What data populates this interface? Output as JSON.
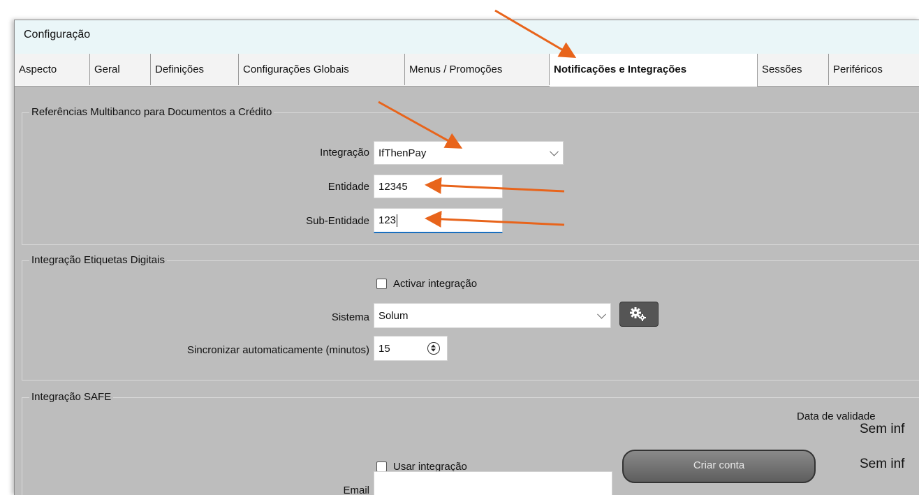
{
  "window": {
    "title": "Configuração"
  },
  "tabs": [
    {
      "label": "Aspecto"
    },
    {
      "label": "Geral"
    },
    {
      "label": "Definições"
    },
    {
      "label": "Configurações Globais"
    },
    {
      "label": "Menus / Promoções"
    },
    {
      "label": "Notificações e Integrações",
      "active": true
    },
    {
      "label": "Sessões"
    },
    {
      "label": "Periféricos"
    }
  ],
  "multibanco": {
    "legend": "Referências Multibanco para Documentos a Crédito",
    "integracao_label": "Integração",
    "integracao_value": "IfThenPay",
    "entidade_label": "Entidade",
    "entidade_value": "12345",
    "subentidade_label": "Sub-Entidade",
    "subentidade_value": "123"
  },
  "etiquetas": {
    "legend": "Integração Etiquetas Digitais",
    "activar_label": "Activar integração",
    "activar_checked": false,
    "sistema_label": "Sistema",
    "sistema_value": "Solum",
    "sync_label": "Sincronizar automaticamente (minutos)",
    "sync_value": "15"
  },
  "safe": {
    "legend": "Integração SAFE",
    "usar_label": "Usar integração",
    "usar_checked": false,
    "email_label": "Email",
    "email_value": "",
    "criar_conta_label": "Criar conta",
    "data_validade_label": "Data de validade",
    "sem_info_1": "Sem inf",
    "sem_info_2": "Sem inf"
  },
  "icons": {
    "gear": "gear-icon",
    "chevron": "chevron-down-icon",
    "spinner": "spinner-updown-icon"
  },
  "colors": {
    "annotation_arrow": "#e8641b",
    "focus_underline": "#1a6fbf"
  }
}
